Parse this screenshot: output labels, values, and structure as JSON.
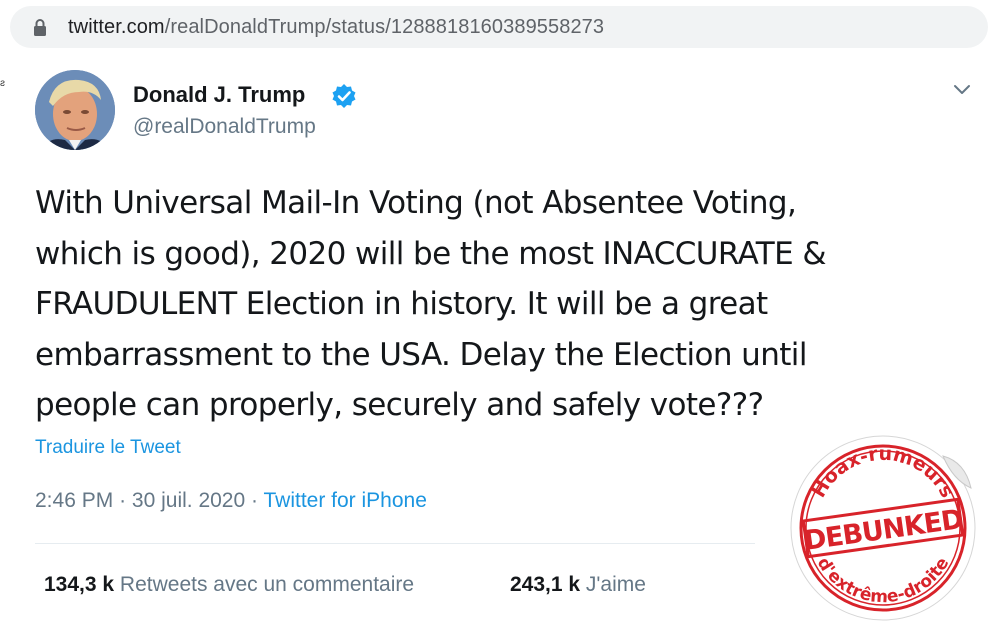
{
  "browser": {
    "url_host": "twitter.com",
    "url_path": "/realDonaldTrump/status/1288818160389558273"
  },
  "tweet": {
    "author_name": "Donald J. Trump",
    "author_handle": "@realDonaldTrump",
    "text_lines": [
      "With Universal Mail-In Voting (not Absentee Voting,",
      "which is good), 2020 will be the most INACCURATE &",
      "FRAUDULENT Election in history. It will be a great",
      "embarrassment to the USA. Delay the Election until",
      "people can properly, securely and safely vote???"
    ],
    "translate_link": "Traduire le Tweet",
    "time": "2:46 PM",
    "date": "30 juil. 2020",
    "separator": "·",
    "source": "Twitter for iPhone",
    "retweets_count": "134,3 k",
    "retweets_label": "Retweets avec un commentaire",
    "likes_count": "243,1 k",
    "likes_label": "J'aime"
  },
  "stamp": {
    "top_text": "Hoax-rumeurs",
    "main_text": "DEBUNKED",
    "bottom_text": "d'extrême-droite",
    "color": "#d8232a"
  },
  "colors": {
    "link": "#1b95e0",
    "secondary_text": "#657786",
    "verified": "#1da1f2"
  }
}
